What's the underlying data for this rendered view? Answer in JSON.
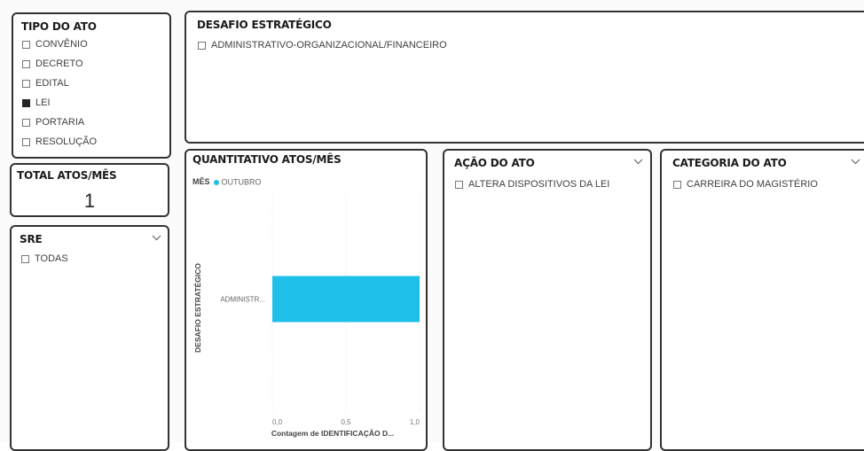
{
  "tipo_do_ato": {
    "title": "TIPO DO ATO",
    "options": [
      {
        "label": "CONVÊNIO",
        "checked": false
      },
      {
        "label": "DECRETO",
        "checked": false
      },
      {
        "label": "EDITAL",
        "checked": false
      },
      {
        "label": "LEI",
        "checked": true
      },
      {
        "label": "PORTARIA",
        "checked": false
      },
      {
        "label": "RESOLUÇÃO",
        "checked": false
      }
    ]
  },
  "desafio": {
    "title": "DESAFIO ESTRATÉGICO",
    "options": [
      {
        "label": "ADMINISTRATIVO-ORGANIZACIONAL/FINANCEIRO",
        "checked": false
      }
    ]
  },
  "total": {
    "title": "TOTAL ATOS/MÊS",
    "value": "1"
  },
  "sre": {
    "title": "SRE",
    "options": [
      {
        "label": "TODAS",
        "checked": false
      }
    ]
  },
  "acao": {
    "title": "AÇÃO DO ATO",
    "options": [
      {
        "label": "ALTERA DISPOSITIVOS DA LEI",
        "checked": false
      }
    ]
  },
  "categoria": {
    "title": "CATEGORIA DO ATO",
    "options": [
      {
        "label": "CARREIRA DO MAGISTÉRIO",
        "checked": false
      }
    ]
  },
  "icons": {
    "dropdown": "chevron-down-icon"
  },
  "colors": {
    "bar": "#1ec0ea",
    "border": "#333333",
    "grid": "#e6e6e6"
  },
  "chart_data": {
    "type": "bar",
    "orientation": "horizontal",
    "title": "QUANTITATIVO ATOS/MÊS",
    "legend_title": "MÊS",
    "legend": "top-left",
    "categories": [
      "ADMINISTR..."
    ],
    "series": [
      {
        "name": "OUTUBRO",
        "values": [
          1.0
        ]
      }
    ],
    "xlabel": "Contagem de IDENTIFICAÇÃO D...",
    "ylabel": "DESAFIO ESTRATÉGICO",
    "xlim": [
      0,
      1
    ],
    "xticks": [
      "0,0",
      "0,5",
      "1,0"
    ],
    "grid": true
  }
}
